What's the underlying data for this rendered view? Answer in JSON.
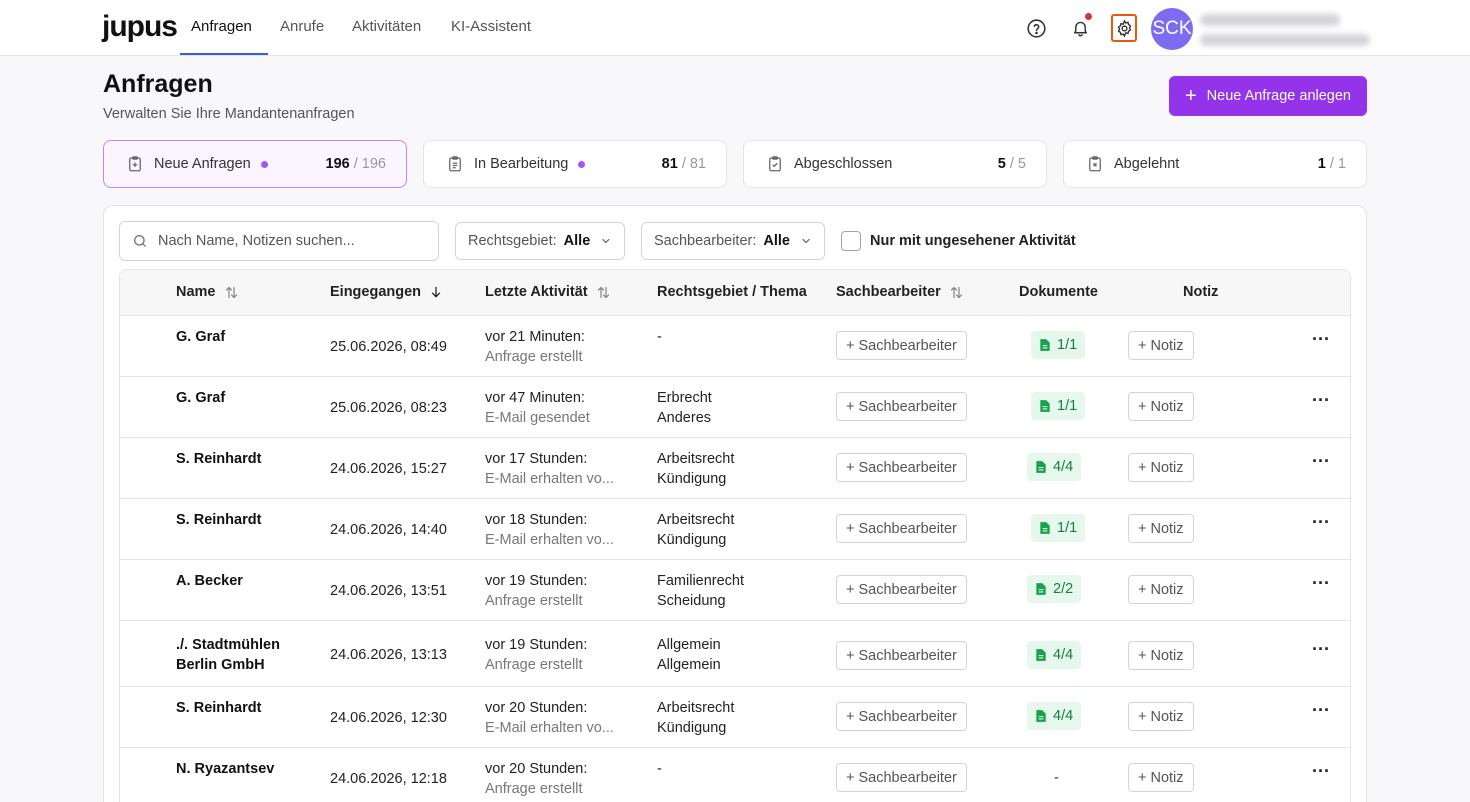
{
  "app": {
    "logo": "jupus",
    "nav": [
      {
        "label": "Anfragen",
        "active": true
      },
      {
        "label": "Anrufe",
        "active": false
      },
      {
        "label": "Aktivitäten",
        "active": false
      },
      {
        "label": "KI-Assistent",
        "active": false
      }
    ],
    "avatar_initials": "SCK",
    "icons": {
      "help": "help-circle-icon",
      "notifications": "bell-icon",
      "settings": "gear-icon"
    }
  },
  "header": {
    "title": "Anfragen",
    "subtitle": "Verwalten Sie Ihre Mandantenanfragen",
    "new_button": "Neue Anfrage anlegen"
  },
  "stats": [
    {
      "label": "Neue Anfragen",
      "count": "196",
      "total": "/ 196",
      "dot": true,
      "active": true
    },
    {
      "label": "In Bearbeitung",
      "count": "81",
      "total": "/ 81",
      "dot": true,
      "active": false
    },
    {
      "label": "Abgeschlossen",
      "count": "5",
      "total": "/ 5",
      "dot": false,
      "active": false
    },
    {
      "label": "Abgelehnt",
      "count": "1",
      "total": "/ 1",
      "dot": false,
      "active": false
    }
  ],
  "filters": {
    "search_placeholder": "Nach Name, Notizen suchen...",
    "rechtsgebiet_label": "Rechtsgebiet:",
    "rechtsgebiet_value": "Alle",
    "sachbearbeiter_label": "Sachbearbeiter:",
    "sachbearbeiter_value": "Alle",
    "unseen_label": "Nur mit ungesehener Aktivität"
  },
  "table": {
    "columns": {
      "name": "Name",
      "received": "Eingegangen",
      "last_activity": "Letzte Aktivität",
      "area": "Rechtsgebiet / Thema",
      "assignee": "Sachbearbeiter",
      "documents": "Dokumente",
      "note": "Notiz"
    },
    "assign_label": "+ Sachbearbeiter",
    "note_label": "+ Notiz",
    "more_label": "···",
    "rows": [
      {
        "name": [
          "G. Graf"
        ],
        "received": "25.06.2026, 08:49",
        "activity_time": "vor 21 Minuten:",
        "activity_text": "Anfrage erstellt",
        "area": [
          "-"
        ],
        "docs": "1/1"
      },
      {
        "name": [
          "G. Graf"
        ],
        "received": "25.06.2026, 08:23",
        "activity_time": "vor 47 Minuten:",
        "activity_text": "E-Mail gesendet",
        "area": [
          "Erbrecht",
          "Anderes"
        ],
        "docs": "1/1"
      },
      {
        "name": [
          "S. Reinhardt"
        ],
        "received": "24.06.2026, 15:27",
        "activity_time": "vor 17 Stunden:",
        "activity_text": "E-Mail erhalten vo...",
        "area": [
          "Arbeitsrecht",
          "Kündigung"
        ],
        "docs": "4/4"
      },
      {
        "name": [
          "S. Reinhardt"
        ],
        "received": "24.06.2026, 14:40",
        "activity_time": "vor 18 Stunden:",
        "activity_text": "E-Mail erhalten vo...",
        "area": [
          "Arbeitsrecht",
          "Kündigung"
        ],
        "docs": "1/1"
      },
      {
        "name": [
          "A. Becker"
        ],
        "received": "24.06.2026, 13:51",
        "activity_time": "vor 19 Stunden:",
        "activity_text": "Anfrage erstellt",
        "area": [
          "Familienrecht",
          "Scheidung"
        ],
        "docs": "2/2"
      },
      {
        "name": [
          "./. Stadtmühlen",
          "Berlin GmbH"
        ],
        "received": "24.06.2026, 13:13",
        "activity_time": "vor 19 Stunden:",
        "activity_text": "Anfrage erstellt",
        "area": [
          "Allgemein",
          "Allgemein"
        ],
        "docs": "4/4"
      },
      {
        "name": [
          "S. Reinhardt"
        ],
        "received": "24.06.2026, 12:30",
        "activity_time": "vor 20 Stunden:",
        "activity_text": "E-Mail erhalten vo...",
        "area": [
          "Arbeitsrecht",
          "Kündigung"
        ],
        "docs": "4/4"
      },
      {
        "name": [
          "N. Ryazantsev"
        ],
        "received": "24.06.2026, 12:18",
        "activity_time": "vor 20 Stunden:",
        "activity_text": "Anfrage erstellt",
        "area": [
          "-"
        ],
        "docs": "-"
      }
    ]
  }
}
